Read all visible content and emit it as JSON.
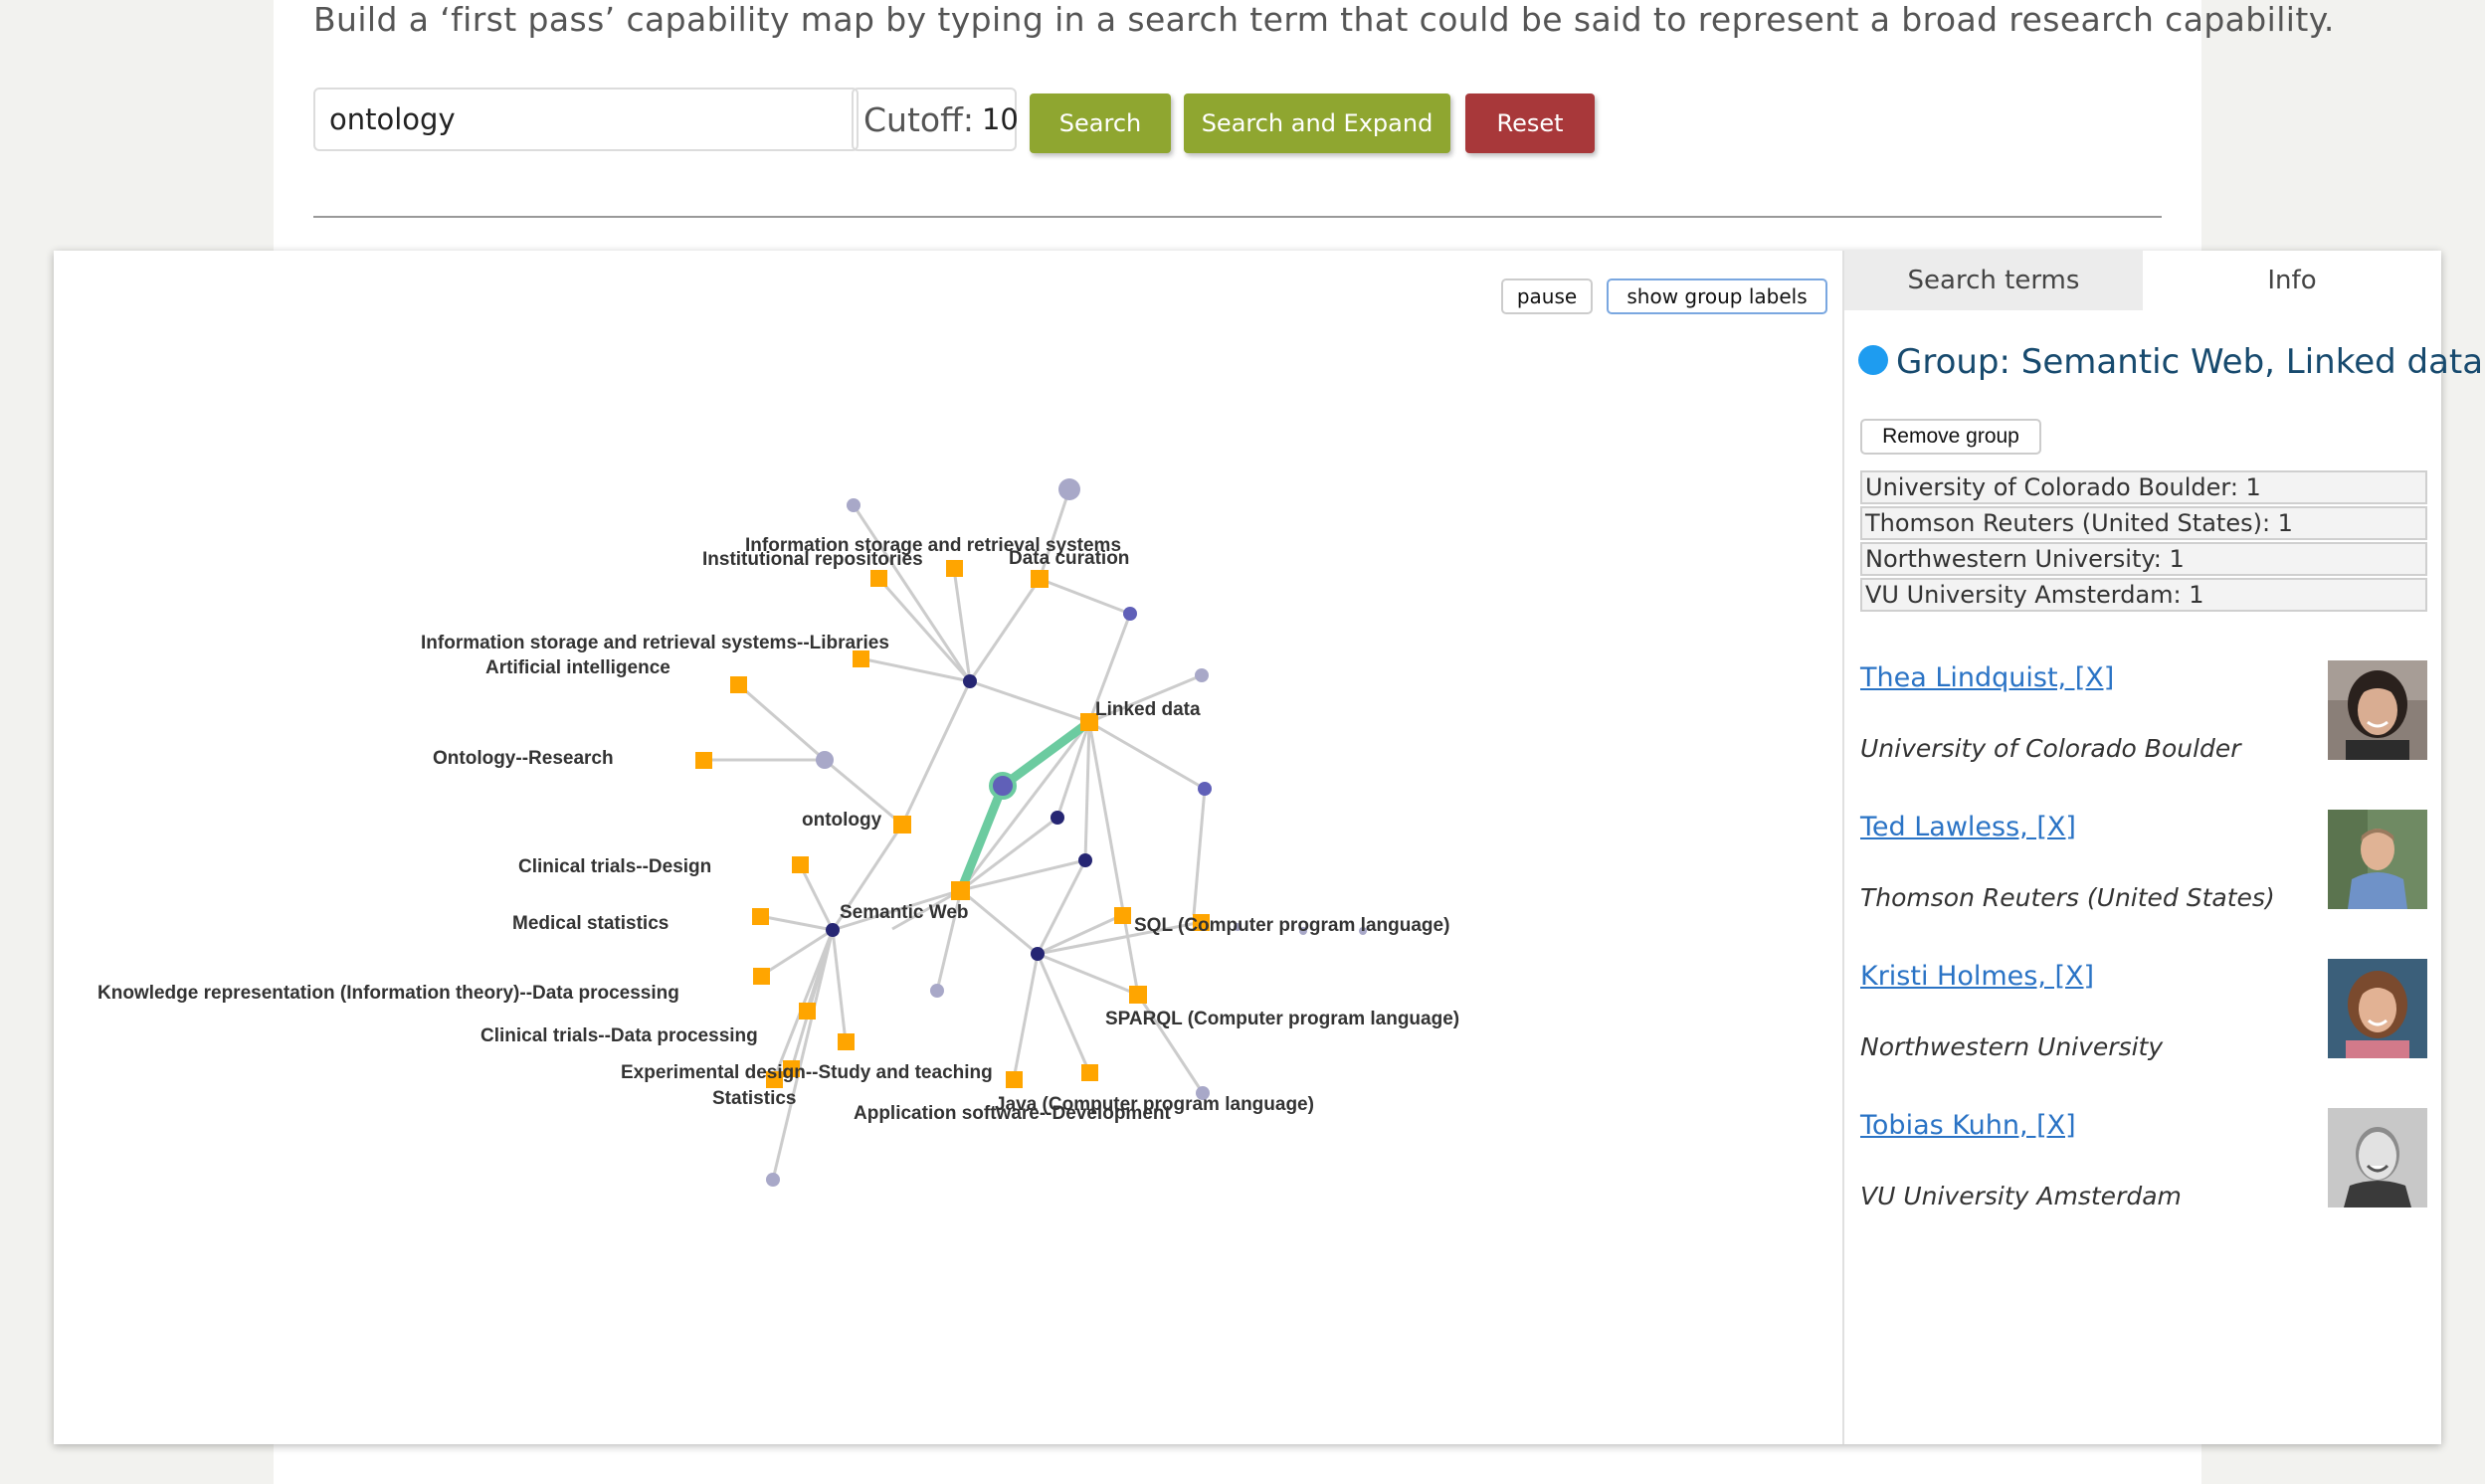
{
  "intro_text": "Build a ‘first pass’ capability map by typing in a search term that could be said to represent a broad research capability.",
  "search": {
    "value": "ontology"
  },
  "cutoff": {
    "label": "Cutoff:",
    "value": "10"
  },
  "buttons": {
    "search": "Search",
    "search_expand": "Search and Expand",
    "reset": "Reset"
  },
  "colors": {
    "primary_button": "#8fa630",
    "reset_button": "#a8383a",
    "term_node": "#ffa500",
    "highlight_edge": "#6ccba0",
    "group_dot": "#1e9cf0",
    "link": "#2a73c5"
  },
  "graph": {
    "pause_label": "pause",
    "group_labels_label": "show group labels",
    "labels": {
      "info_storage": "Information storage and retrieval systems",
      "institutional_repos": "Institutional repositories",
      "data_curation": "Data curation",
      "info_storage_libraries": "Information storage and retrieval systems--Libraries",
      "ai": "Artificial intelligence",
      "linked_data": "Linked data",
      "ontology_research": "Ontology--Research",
      "ontology": "ontology",
      "clinical_design": "Clinical trials--Design",
      "medical_stats": "Medical statistics",
      "semantic_web": "Semantic Web",
      "sql": "SQL (Computer program language)",
      "knowledge_rep": "Knowledge representation (Information theory)--Data processing",
      "sparql": "SPARQL (Computer program language)",
      "clinical_data": "Clinical trials--Data processing",
      "exp_design": "Experimental design--Study and teaching",
      "statistics": "Statistics",
      "java": "Java (Computer program language)",
      "app_software": "Application software--Development"
    }
  },
  "panel": {
    "tabs": [
      "Search terms",
      "Info"
    ],
    "group_title": "Group: Semantic Web, Linked data",
    "remove_label": "Remove group",
    "orgs": [
      "University of Colorado Boulder: 1",
      "Thomson Reuters (United States): 1",
      "Northwestern University: 1",
      "VU University Amsterdam: 1"
    ],
    "people": [
      {
        "name": "Thea Lindquist, [X]",
        "org": "University of Colorado Boulder"
      },
      {
        "name": "Ted Lawless, [X]",
        "org": "Thomson Reuters (United States)"
      },
      {
        "name": "Kristi Holmes, [X]",
        "org": "Northwestern University"
      },
      {
        "name": "Tobias Kuhn, [X]",
        "org": "VU University Amsterdam"
      }
    ]
  }
}
